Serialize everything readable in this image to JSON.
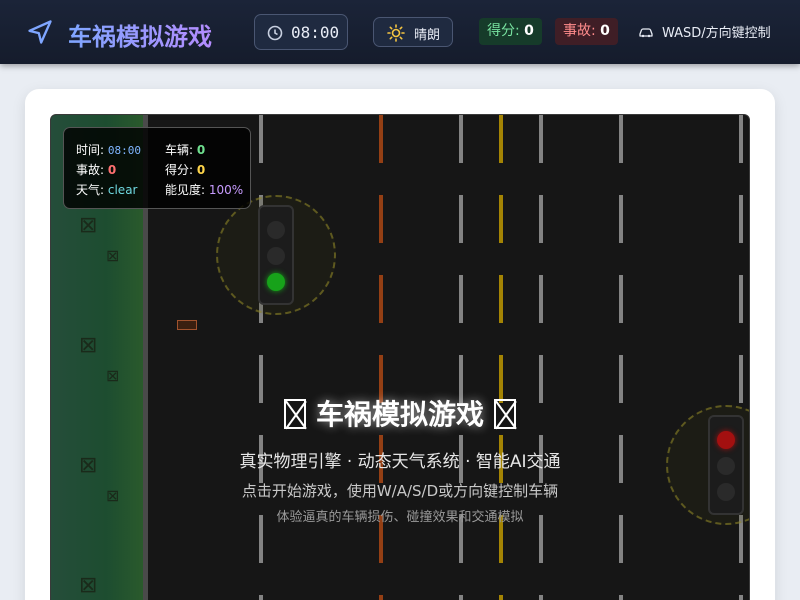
{
  "header": {
    "title": "车祸模拟游戏",
    "logo_icon": "navigation-arrow-icon",
    "clock": {
      "icon": "clock-icon",
      "time": "08:00"
    },
    "weather": {
      "icon": "sun-icon",
      "label": "晴朗"
    },
    "score": {
      "label": "得分:",
      "value": "0"
    },
    "accidents": {
      "label": "事故:",
      "value": "0"
    },
    "controls": {
      "icon": "car-icon",
      "label": "WASD/方向键控制"
    }
  },
  "hud": {
    "time_label": "时间:",
    "time_value": "08:00",
    "vehicles_label": "车辆:",
    "vehicles_value": "0",
    "accidents_label": "事故:",
    "accidents_value": "0",
    "score_label": "得分:",
    "score_value": "0",
    "weather_label": "天气:",
    "weather_value": "clear",
    "visibility_label": "能见度:",
    "visibility_value": "100%"
  },
  "overlay": {
    "title": "车祸模拟游戏",
    "subtitle": "真实物理引擎 · 动态天气系统 · 智能AI交通",
    "hint": "点击开始游戏，使用W/A/S/D或方向键控制车辆",
    "note": "体验逼真的车辆损伤、碰撞效果和交通模拟"
  },
  "colors": {
    "accent": "#8fa8ff",
    "header_bg": "#1b2438",
    "road": "#161616",
    "green_light": "#17a21a",
    "red_light": "#a31010"
  }
}
